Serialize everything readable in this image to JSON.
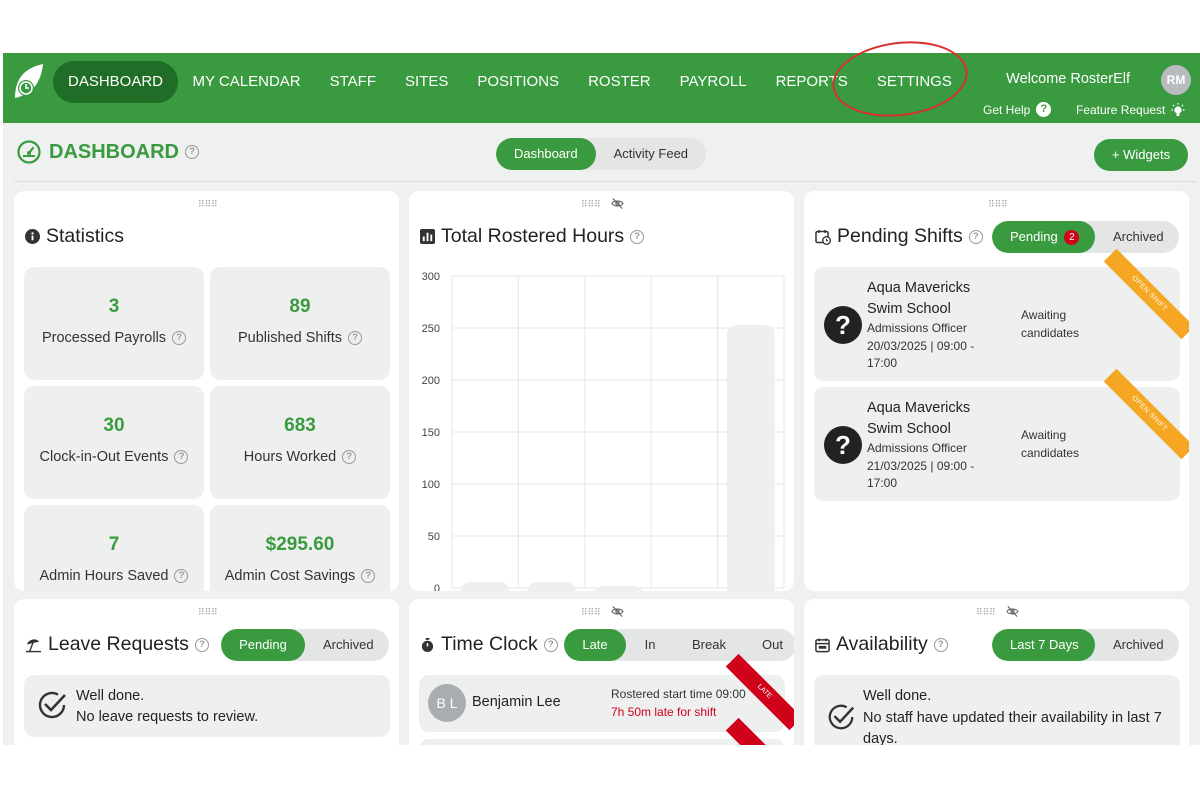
{
  "nav": {
    "items": [
      "DASHBOARD",
      "MY CALENDAR",
      "STAFF",
      "SITES",
      "POSITIONS",
      "ROSTER",
      "PAYROLL",
      "REPORTS",
      "SETTINGS"
    ],
    "welcome": "Welcome RosterElf",
    "avatar_initials": "RM",
    "get_help": "Get Help",
    "feature_request": "Feature Request"
  },
  "header": {
    "title": "DASHBOARD",
    "tabs": [
      "Dashboard",
      "Activity Feed"
    ],
    "add_widgets": "+ Widgets"
  },
  "statistics": {
    "title": "Statistics",
    "items": [
      {
        "value": "3",
        "label": "Processed Payrolls"
      },
      {
        "value": "89",
        "label": "Published Shifts"
      },
      {
        "value": "30",
        "label": "Clock-in-Out Events"
      },
      {
        "value": "683",
        "label": "Hours Worked"
      },
      {
        "value": "7",
        "label": "Admin Hours Saved"
      },
      {
        "value": "$295.60",
        "label": "Admin Cost Savings"
      }
    ]
  },
  "rostered_hours": {
    "title": "Total Rostered Hours"
  },
  "chart_data": {
    "type": "bar",
    "title": "Total Rostered Hours",
    "categories": [
      "",
      "",
      "",
      "",
      ""
    ],
    "values": [
      6,
      6,
      2,
      0,
      253
    ],
    "ylim": [
      0,
      300
    ],
    "yticks": [
      "300",
      "250",
      "200",
      "150",
      "100",
      "50",
      "0"
    ],
    "grid": true,
    "bar_color": "#eef0ef"
  },
  "pending_shifts": {
    "title": "Pending Shifts",
    "tabs": [
      "Pending",
      "Archived"
    ],
    "badge": "2",
    "ribbon": "OPEN SHIFT",
    "shifts": [
      {
        "site_line1": "Aqua Mavericks",
        "site_line2": "Swim School",
        "position": "Admissions Officer",
        "time_line1": "20/03/2025 | 09:00 -",
        "time_line2": "17:00",
        "status_line1": "Awaiting",
        "status_line2": "candidates"
      },
      {
        "site_line1": "Aqua Mavericks",
        "site_line2": "Swim School",
        "position": "Admissions Officer",
        "time_line1": "21/03/2025 | 09:00 -",
        "time_line2": "17:00",
        "status_line1": "Awaiting",
        "status_line2": "candidates"
      }
    ]
  },
  "leave_requests": {
    "title": "Leave Requests",
    "tabs": [
      "Pending",
      "Archived"
    ],
    "msg_line1": "Well done.",
    "msg_line2": "No leave requests to review."
  },
  "time_clock": {
    "title": "Time Clock",
    "tabs": [
      "Late",
      "In",
      "Break",
      "Out"
    ],
    "ribbon": "LATE",
    "entry": {
      "initials": "B L",
      "name": "Benjamin Lee",
      "start": "Rostered start time 09:00",
      "late": "7h 50m late for shift"
    }
  },
  "availability": {
    "title": "Availability",
    "tabs": [
      "Last 7 Days",
      "Archived"
    ],
    "msg_line1": "Well done.",
    "msg_line2": "No staff have updated their availability in last 7",
    "msg_line3": "days."
  },
  "colors": {
    "brand_green": "#3a9a3f",
    "dark_green": "#1f6d27",
    "late_red": "#d0021b",
    "annotation_red": "#d9312b"
  }
}
